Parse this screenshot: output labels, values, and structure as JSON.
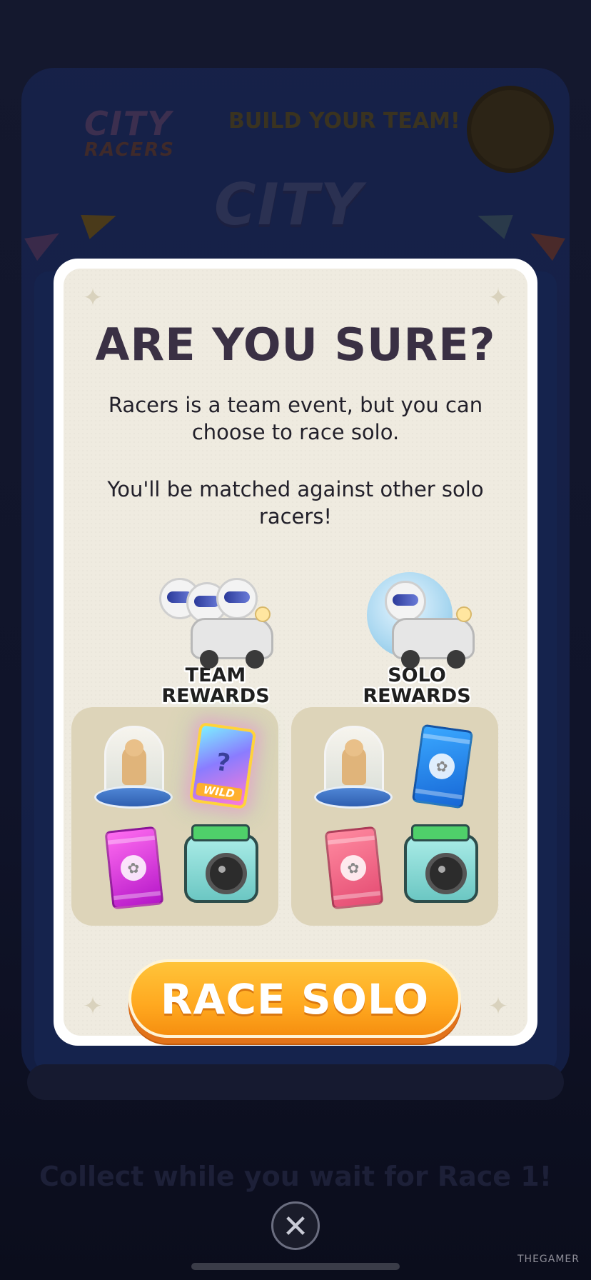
{
  "background": {
    "event_logo_line1": "CITY",
    "event_logo_line2": "RACERS",
    "build_team_label": "BUILD YOUR TEAM!",
    "big_logo": "CITY",
    "collect_text": "Collect  while you wait for Race 1!"
  },
  "modal": {
    "title": "ARE YOU SURE?",
    "message_1": "Racers is a team event, but you can choose to race solo.",
    "message_2": "You'll be matched against other solo racers!",
    "team_rewards_label": "TEAM\nREWARDS",
    "solo_rewards_label": "SOLO\nREWARDS",
    "team_rewards_items": [
      "trophy-dome",
      "wild-card",
      "sticker-pack-purple",
      "tire-jar"
    ],
    "solo_rewards_items": [
      "trophy-dome",
      "sticker-pack-blue",
      "sticker-pack-pink",
      "tire-jar"
    ],
    "wild_card_label": "WILD",
    "race_solo_button": "RACE SOLO"
  },
  "close_button": "✕",
  "watermark": "THEGAMER",
  "colors": {
    "modal_bg": "#efebe0",
    "title": "#3a3044",
    "button": "#ffa81f",
    "reward_box": "#ddd4b9"
  }
}
